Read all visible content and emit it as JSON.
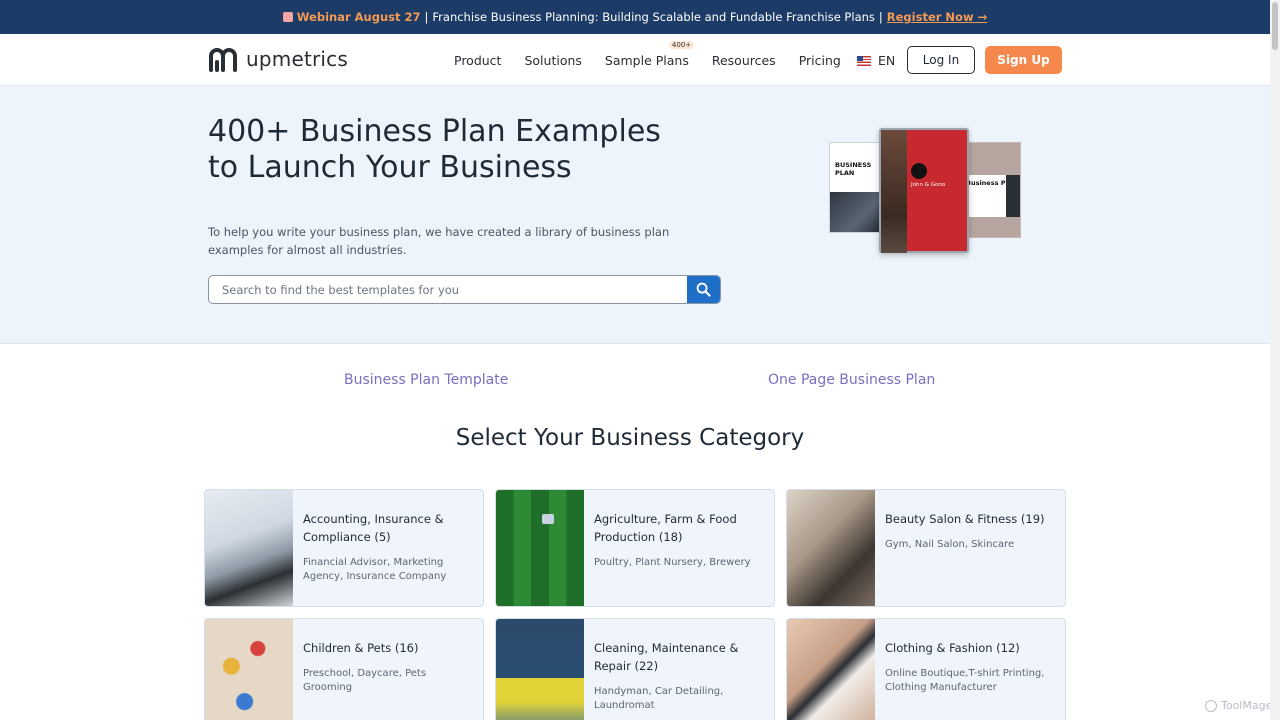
{
  "promo": {
    "webinar": "Webinar August 27",
    "separator": "|",
    "text": "Franchise Business Planning: Building Scalable and Fundable Franchise Plans",
    "separator2": "|",
    "cta": "Register Now →"
  },
  "header": {
    "logo_text": "upmetrics",
    "nav": [
      {
        "label": "Product"
      },
      {
        "label": "Solutions"
      },
      {
        "label": "Sample Plans",
        "badge": "400+"
      },
      {
        "label": "Resources"
      },
      {
        "label": "Pricing"
      }
    ],
    "language": "EN",
    "login": "Log In",
    "signup": "Sign Up"
  },
  "hero": {
    "title": "400+ Business Plan Examples to Launch Your Business",
    "description": "To help you write your business plan, we have created a library of business plan examples for almost all industries.",
    "search_placeholder": "Search to find the best templates for you",
    "brochure_left": "BUSINESS PLAN",
    "brochure_right": "Business Plan",
    "brochure_mid": "John & Gono"
  },
  "links": {
    "template": "Business Plan Template",
    "one_page": "One Page Business Plan"
  },
  "section_title": "Select Your Business Category",
  "categories": [
    {
      "title": "Accounting, Insurance & Compliance (5)",
      "sub": "Financial Advisor, Marketing Agency, Insurance Company"
    },
    {
      "title": "Agriculture, Farm & Food Production (18)",
      "sub": "Poultry, Plant Nursery, Brewery"
    },
    {
      "title": "Beauty Salon & Fitness (19)",
      "sub": "Gym, Nail Salon, Skincare"
    },
    {
      "title": "Children & Pets (16)",
      "sub": "Preschool, Daycare, Pets Grooming"
    },
    {
      "title": "Cleaning, Maintenance & Repair (22)",
      "sub": "Handyman, Car Detailing, Laundromat"
    },
    {
      "title": "Clothing & Fashion (12)",
      "sub": "Online Boutique,T-shirt Printing, Clothing Manufacturer"
    }
  ],
  "watermark": "ToolMage",
  "colors": {
    "promo_bg": "#1c3b66",
    "accent_orange": "#f5894d",
    "search_button": "#1f6fc9",
    "link_purple": "#7a6fc0",
    "hero_bg": "#eef4fb"
  },
  "icons": {
    "search": "search-icon",
    "calendar": "calendar-icon",
    "flag": "us-flag-icon",
    "logo": "upmetrics-logo-icon"
  }
}
